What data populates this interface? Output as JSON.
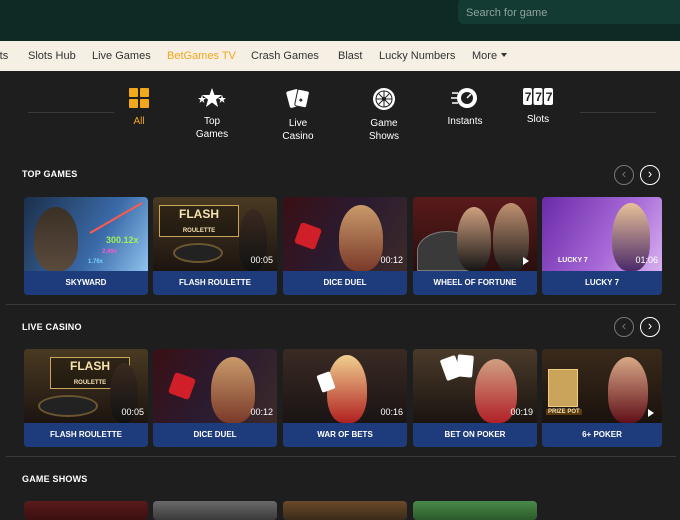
{
  "header": {
    "search_placeholder": "Search for game"
  },
  "nav": {
    "items": [
      "rts",
      "Slots Hub",
      "Live Games",
      "BetGames TV",
      "Crash Games",
      "Blast",
      "Lucky Numbers",
      "More"
    ]
  },
  "categories": [
    {
      "label": "All",
      "icon": "grid-icon"
    },
    {
      "label": "Top Games",
      "icon": "stars-icon"
    },
    {
      "label": "Live Casino",
      "icon": "cards-icon"
    },
    {
      "label": "Game Shows",
      "icon": "wheel-icon"
    },
    {
      "label": "Instants",
      "icon": "speedometer-icon"
    },
    {
      "label": "Slots",
      "icon": "777-icon"
    }
  ],
  "sections": {
    "top_games": {
      "title": "TOP GAMES",
      "cards": [
        {
          "label": "SKYWARD",
          "timer": "",
          "overlay": "300.12x",
          "overlay2": "2.49x",
          "overlay3": "1.76x"
        },
        {
          "label": "FLASH ROULETTE",
          "timer": "00:05",
          "overlay": "FLASH",
          "overlay2": "ROULETTE"
        },
        {
          "label": "DICE DUEL",
          "timer": "00:12"
        },
        {
          "label": "WHEEL OF FORTUNE",
          "timer": ""
        },
        {
          "label": "LUCKY 7",
          "timer": "01:06",
          "overlay": "LUCKY 7"
        }
      ]
    },
    "live_casino": {
      "title": "LIVE CASINO",
      "cards": [
        {
          "label": "FLASH ROULETTE",
          "timer": "00:05",
          "overlay": "FLASH",
          "overlay2": "ROULETTE"
        },
        {
          "label": "DICE DUEL",
          "timer": "00:12"
        },
        {
          "label": "WAR OF BETS",
          "timer": "00:16"
        },
        {
          "label": "BET ON POKER",
          "timer": "00:19"
        },
        {
          "label": "6+ POKER",
          "timer": "",
          "overlay": "PRIZE POT"
        }
      ]
    },
    "game_shows": {
      "title": "GAME SHOWS"
    }
  },
  "colors": {
    "accent": "#f2a81d",
    "card_label_bg": "#1e3c7c",
    "topbar": "#0e2a24",
    "nav_bg": "#f5efe4"
  }
}
